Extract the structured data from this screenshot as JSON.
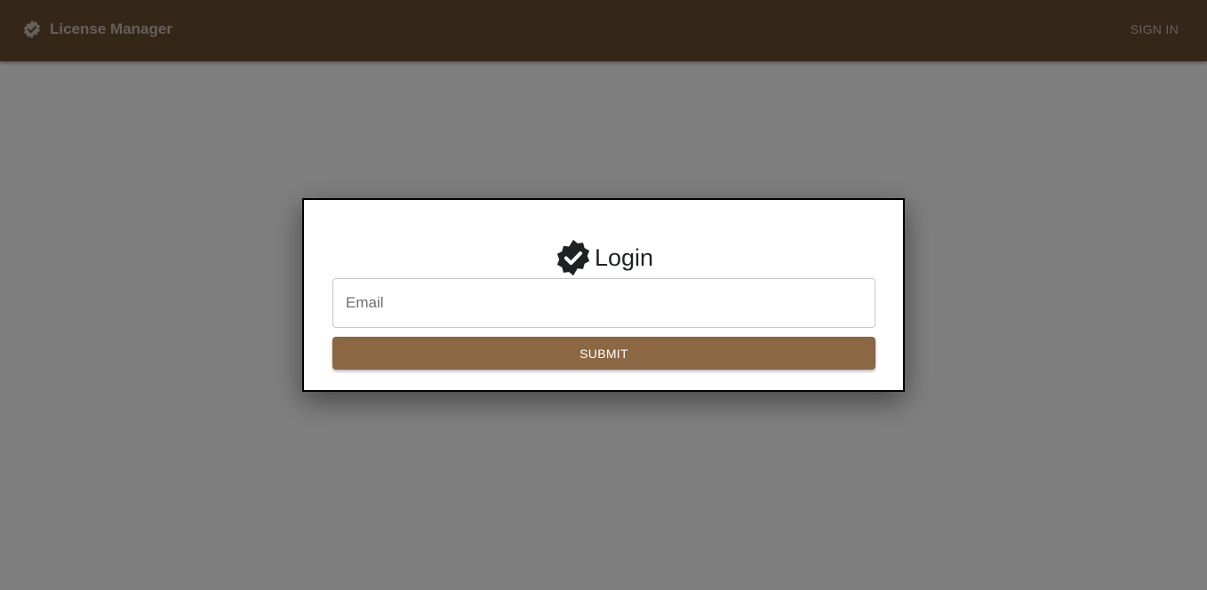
{
  "header": {
    "icon": "verified-badge-icon",
    "title": "License Manager",
    "signin_label": "SIGN IN"
  },
  "modal": {
    "icon": "verified-badge-icon",
    "title": "Login",
    "email": {
      "placeholder": "Email",
      "value": ""
    },
    "submit_label": "SUBMIT"
  },
  "colors": {
    "appbar": "#6b4e31",
    "backdrop": "rgba(0,0,0,0.5)",
    "submit_button": "#8c6743",
    "modal_border": "#000000"
  }
}
